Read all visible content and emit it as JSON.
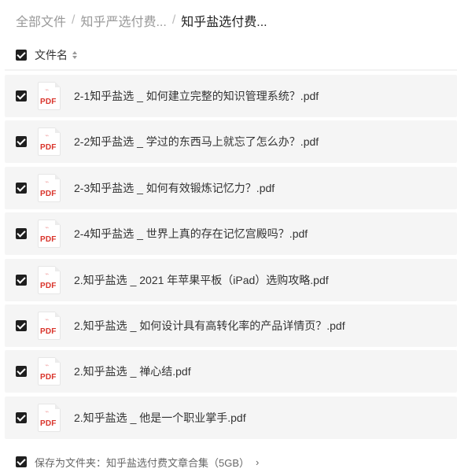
{
  "breadcrumb": {
    "items": [
      "全部文件",
      "知乎严选付费...",
      "知乎盐选付费..."
    ],
    "separator": "/"
  },
  "header": {
    "column_label": "文件名"
  },
  "files": [
    {
      "icon_text": "PDF",
      "name": "2-1知乎盐选 _ 如何建立完整的知识管理系统？.pdf"
    },
    {
      "icon_text": "PDF",
      "name": "2-2知乎盐选 _ 学过的东西马上就忘了怎么办？.pdf"
    },
    {
      "icon_text": "PDF",
      "name": "2-3知乎盐选 _ 如何有效锻炼记忆力？.pdf"
    },
    {
      "icon_text": "PDF",
      "name": "2-4知乎盐选 _ 世界上真的存在记忆宫殿吗？.pdf"
    },
    {
      "icon_text": "PDF",
      "name": "2.知乎盐选 _ 2021 年苹果平板（iPad）选购攻略.pdf"
    },
    {
      "icon_text": "PDF",
      "name": "2.知乎盐选 _ 如何设计具有高转化率的产品详情页？.pdf"
    },
    {
      "icon_text": "PDF",
      "name": "2.知乎盐选 _ 禅心结.pdf"
    },
    {
      "icon_text": "PDF",
      "name": "2.知乎盐选 _ 他是一个职业掌手.pdf"
    }
  ],
  "footer": {
    "save_label": "保存为文件夹：知乎盐选付费文章合集（5GB）",
    "chevron": "›"
  },
  "colors": {
    "checkbox": "#1f1f1f",
    "pdf_red": "#d9342b",
    "row_bg": "#f5f5f5"
  },
  "icons": {
    "file": "pdf-file-icon",
    "sort": "sort-icon",
    "check": "checkbox-checked-icon"
  }
}
